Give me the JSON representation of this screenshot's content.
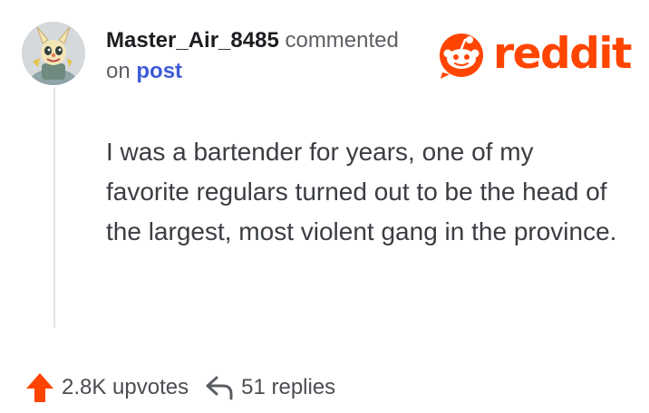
{
  "comment": {
    "username": "Master_Air_8485",
    "action_text": "commented",
    "on_text": "on",
    "post_link_text": "post",
    "body": "I was a bartender for years, one of my favorite regulars turned out to be the head of the largest, most violent gang in the province."
  },
  "brand": {
    "wordmark": "reddit",
    "color": "#ff4500"
  },
  "footer": {
    "upvotes_text": "2.8K upvotes",
    "replies_text": "51 replies"
  },
  "icons": {
    "avatar": "avatar",
    "brand_logo": "reddit-snoo-icon",
    "upvote": "upvote-arrow-icon",
    "reply": "reply-arrow-icon"
  },
  "colors": {
    "accent": "#ff4500",
    "link": "#3d5bd6",
    "text": "#3a3d42"
  }
}
